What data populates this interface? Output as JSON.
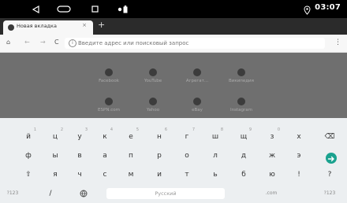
{
  "status_bar": {
    "time": "03:07"
  },
  "browser": {
    "tab": {
      "title": "Новая вкладка",
      "close_glyph": "×"
    },
    "new_tab_glyph": "+",
    "address_placeholder": "Введите адрес или поисковый запрос",
    "info_glyph": "i",
    "menu_glyph": "⋮",
    "nav": {
      "home": "⌂",
      "back": "←",
      "forward": "→",
      "reload": "C"
    }
  },
  "shortcuts": [
    {
      "label": "Facebook"
    },
    {
      "label": "YouTube"
    },
    {
      "label": "Агрегат..."
    },
    {
      "label": "Википедия"
    },
    {
      "label": "ESPN.com"
    },
    {
      "label": "Yahoo"
    },
    {
      "label": "eBay"
    },
    {
      "label": "Instagram"
    }
  ],
  "keyboard": {
    "row1": [
      {
        "char": "й",
        "hint": "1"
      },
      {
        "char": "ц",
        "hint": "2"
      },
      {
        "char": "у",
        "hint": "3"
      },
      {
        "char": "к",
        "hint": "4"
      },
      {
        "char": "е",
        "hint": "5"
      },
      {
        "char": "н",
        "hint": "6"
      },
      {
        "char": "г",
        "hint": "7"
      },
      {
        "char": "ш",
        "hint": "8"
      },
      {
        "char": "щ",
        "hint": "9"
      },
      {
        "char": "з",
        "hint": "0"
      },
      {
        "char": "х",
        "hint": ""
      }
    ],
    "row2": [
      "ф",
      "ы",
      "в",
      "а",
      "п",
      "р",
      "о",
      "л",
      "д",
      "ж",
      "э"
    ],
    "row3": [
      "я",
      "ч",
      "с",
      "м",
      "и",
      "т",
      "ь",
      "б",
      "ю",
      "!",
      "?"
    ],
    "bottom": {
      "symbols": "?123",
      "slash": "/",
      "space": "Русский",
      "dotcom": ".com",
      "symbols_right": "?123"
    },
    "icons": {
      "backspace": "⌫",
      "shift": "⇧",
      "emoji": "☺"
    },
    "accent_color": "#1aa28f"
  }
}
